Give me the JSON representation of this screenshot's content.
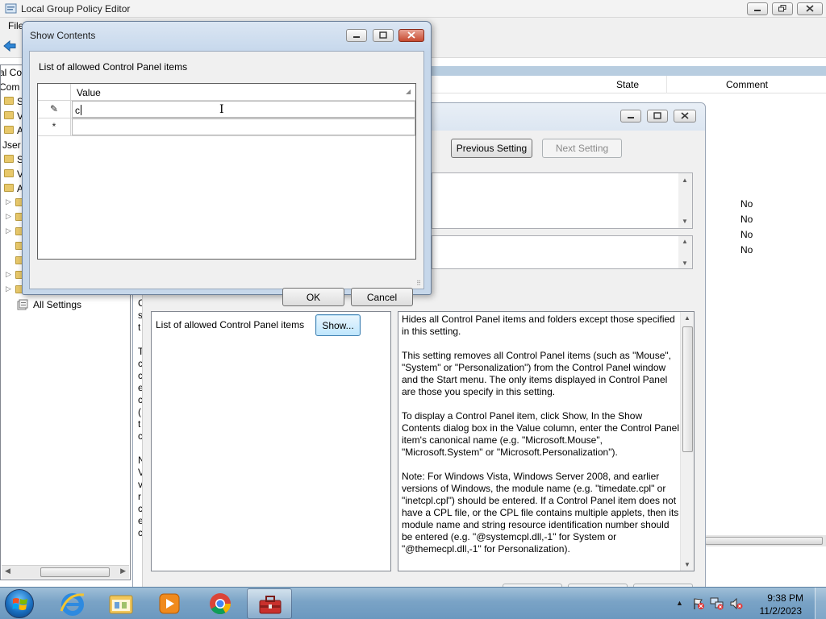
{
  "main_window": {
    "title": "Local Group Policy Editor",
    "menu_file": "File",
    "tree": {
      "items": [
        {
          "label": "al Co",
          "indent": 0
        },
        {
          "label": "Com",
          "indent": 0
        },
        {
          "label": "S",
          "indent": 1
        },
        {
          "label": "V",
          "indent": 1
        },
        {
          "label": "A",
          "indent": 1
        },
        {
          "label": "Jser",
          "indent": 0
        },
        {
          "label": "S",
          "indent": 1
        },
        {
          "label": "V",
          "indent": 1
        },
        {
          "label": "A",
          "indent": 1
        }
      ],
      "all_settings": "All Settings"
    },
    "columns": {
      "state": "State",
      "comment": "Comment"
    },
    "no_values": [
      "No",
      "No",
      "No",
      "No"
    ]
  },
  "setting_dialog": {
    "previous_setting": "Previous Setting",
    "next_setting": "Next Setting",
    "left_strip_chars": [
      "C",
      "s",
      "t",
      "",
      "T",
      "c",
      "c",
      "e",
      "c",
      "(",
      "t",
      "c",
      "",
      "N",
      "V",
      "v",
      "r",
      "c",
      "e",
      "c"
    ],
    "options_label": "List of allowed Control Panel items",
    "show_button": "Show...",
    "help_paragraphs": [
      "Hides all Control Panel items and folders except those specified in this setting.",
      "This setting removes all Control Panel items (such as \"Mouse\", \"System\" or \"Personalization\") from the Control Panel window and the Start menu. The only items displayed in Control Panel are those you specify in this setting.",
      "To display a Control Panel item, click Show, In the Show Contents dialog box in the Value column, enter the Control Panel item's canonical name (e.g. \"Microsoft.Mouse\", \"Microsoft.System\" or \"Microsoft.Personalization\").",
      "Note: For Windows Vista, Windows Server 2008, and earlier versions of Windows, the module name (e.g. \"timedate.cpl\" or \"inetcpl.cpl\") should be entered. If a Control Panel item does not have a CPL file, or the CPL file contains multiple applets, then its module name and string resource identification number should be entered (e.g. \"@systemcpl.dll,-1\" for System or \"@themecpl.dll,-1\" for Personalization)."
    ]
  },
  "show_contents_dialog": {
    "title": "Show Contents",
    "list_label": "List of allowed Control Panel items",
    "column_header": "Value",
    "rows": [
      {
        "marker": "✎",
        "value": "c"
      },
      {
        "marker": "*",
        "value": ""
      }
    ],
    "ok": "OK",
    "cancel": "Cancel"
  },
  "taskbar": {
    "apps": [
      "internet-explorer",
      "windows-explorer",
      "media-player",
      "chrome",
      "group-policy-editor"
    ],
    "active_app": "group-policy-editor",
    "time": "9:38 PM",
    "date": "11/2/2023"
  },
  "colors": {
    "taskbar": "#7aa3c6",
    "dialog_frame": "#c6d7ea",
    "accent": "#3c7fb1"
  }
}
